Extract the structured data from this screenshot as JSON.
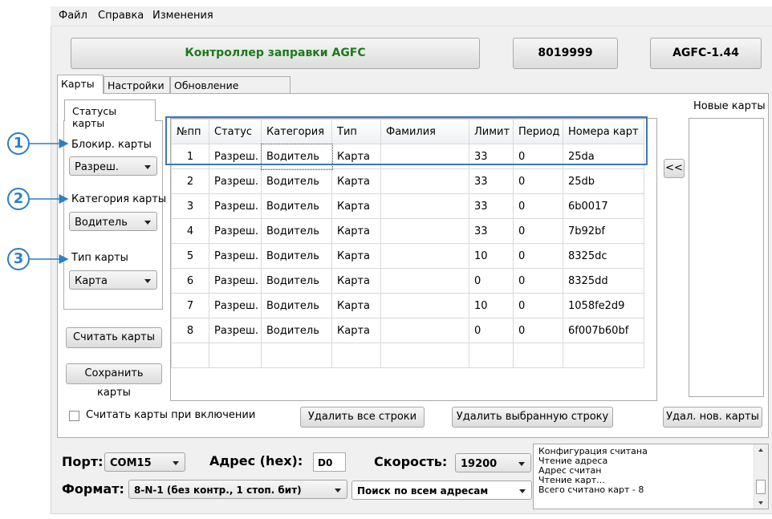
{
  "menu": [
    "Файл",
    "Справка",
    "Изменения"
  ],
  "header": {
    "title": "Контроллер заправки AGFC",
    "serial": "8019999",
    "version": "AGFC-1.44"
  },
  "tabs": [
    "Карты",
    "Настройки",
    "Обновление прошивки"
  ],
  "subtab": "Статусы карты",
  "left": {
    "block_label": "Блокир. карты",
    "block_value": "Разреш.",
    "category_label": "Категория карты",
    "category_value": "Водитель",
    "type_label": "Тип карты",
    "type_value": "Карта",
    "read_button": "Считать карты",
    "save_button": "Сохранить карты"
  },
  "callouts": [
    "1",
    "2",
    "3"
  ],
  "table": {
    "columns": [
      "№пп",
      "Статус",
      "Категория",
      "Тип",
      "Фамилия",
      "Лимит",
      "Период",
      "Номера карт"
    ],
    "rows": [
      [
        "1",
        "Разреш.",
        "Водитель",
        "Карта",
        "",
        "33",
        "0",
        "25da"
      ],
      [
        "2",
        "Разреш.",
        "Водитель",
        "Карта",
        "",
        "33",
        "0",
        "25db"
      ],
      [
        "3",
        "Разреш.",
        "Водитель",
        "Карта",
        "",
        "33",
        "0",
        "6b0017"
      ],
      [
        "4",
        "Разреш.",
        "Водитель",
        "Карта",
        "",
        "33",
        "0",
        "7b92bf"
      ],
      [
        "5",
        "Разреш.",
        "Водитель",
        "Карта",
        "",
        "10",
        "0",
        "8325dc"
      ],
      [
        "6",
        "Разреш.",
        "Водитель",
        "Карта",
        "",
        "0",
        "0",
        "8325dd"
      ],
      [
        "7",
        "Разреш.",
        "Водитель",
        "Карта",
        "",
        "10",
        "0",
        "1058fe2d9"
      ],
      [
        "8",
        "Разреш.",
        "Водитель",
        "Карта",
        "",
        "0",
        "0",
        "6f007b60bf"
      ]
    ]
  },
  "new_cards_label": "Новые карты",
  "move_button": "<<",
  "read_on_start_label": "Считать карты при включении",
  "delete_all_button": "Удалить все строки",
  "delete_selected_button": "Удалить выбранную строку",
  "delete_new_button": "Удал. нов. карты",
  "bottom": {
    "port_label": "Порт:",
    "port_value": "COM15",
    "address_label": "Адрес (hex):",
    "address_value": "D0",
    "speed_label": "Скорость:",
    "speed_value": "19200",
    "format_label": "Формат:",
    "format_value": "8-N-1 (без контр., 1 стоп. бит)",
    "search_value": "Поиск по всем адресам"
  },
  "status_log": [
    "Конфигурация считана",
    "Чтение адреса",
    "Адрес считан",
    "Чтение карт...",
    "Всего считано карт - 8"
  ],
  "colors": {
    "title_green": "#1a7a1a",
    "callout_blue": "#2e7fc0",
    "highlight_border": "#3b78b5"
  }
}
